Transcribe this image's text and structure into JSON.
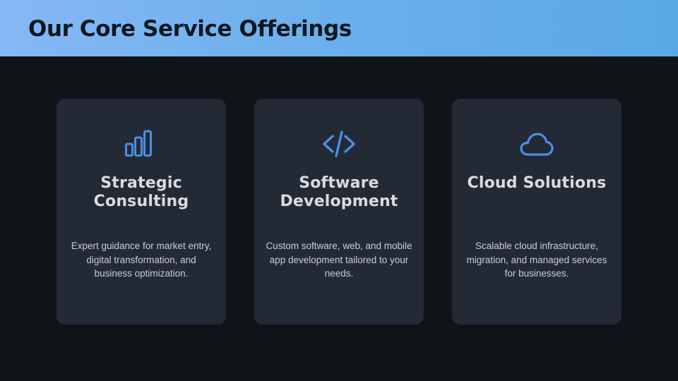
{
  "header": {
    "title": "Our Core Service Offerings"
  },
  "colors": {
    "header_gradient_start": "#86b8f5",
    "header_gradient_end": "#5aa9e4",
    "background": "#101419",
    "card_background": "#242a35",
    "icon_accent": "#4a8fe7",
    "title_text": "#d8dbe0",
    "body_text": "#c9cdd3"
  },
  "cards": [
    {
      "icon": "bar-chart-icon",
      "title": "Strategic Consulting",
      "description": "Expert guidance for market entry, digital transformation, and business optimization."
    },
    {
      "icon": "code-icon",
      "title": "Software Development",
      "description": "Custom software, web, and mobile app development tailored to your needs."
    },
    {
      "icon": "cloud-icon",
      "title": "Cloud Solutions",
      "description": "Scalable cloud infrastructure, migration, and managed services for businesses."
    }
  ]
}
